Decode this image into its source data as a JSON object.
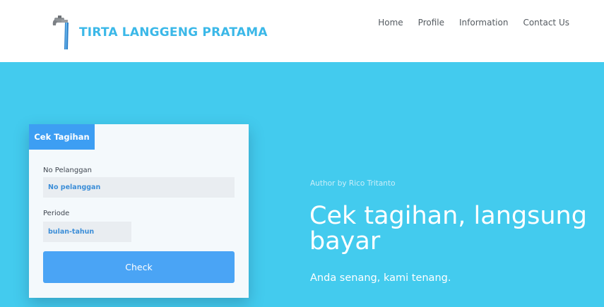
{
  "header": {
    "brand_name": "TIRTA LANGGENG PRATAMA",
    "logo_icon": "water-faucet-icon",
    "nav": [
      "Home",
      "Profile",
      "Information",
      "Contact Us"
    ]
  },
  "card": {
    "tab_label": "Cek Tagihan",
    "customer_label": "No Pelanggan",
    "customer_placeholder": "No pelanggan",
    "period_label": "Periode",
    "period_placeholder": "bulan-tahun",
    "check_label": "Check"
  },
  "hero": {
    "author": "Author by Rico Tritanto",
    "headline_line1": "Cek tagihan, langsung",
    "headline_line2": "bayar",
    "subheadline": "Anda senang, kami tenang."
  },
  "colors": {
    "hero_bg": "#43cbee",
    "accent": "#3d9ef3",
    "brand": "#3bb8e8"
  }
}
